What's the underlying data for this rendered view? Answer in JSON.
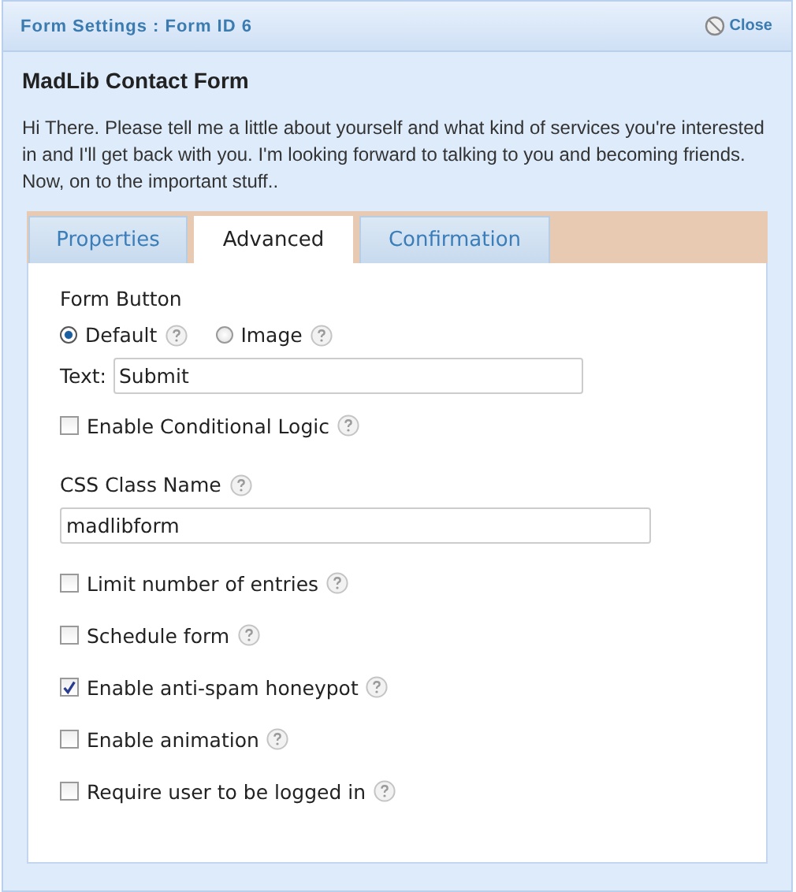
{
  "header": {
    "title": "Form Settings : Form ID 6",
    "close_label": "Close"
  },
  "form_title": "MadLib Contact Form",
  "description": "Hi There. Please tell me a little about yourself and what kind of services you're interested in and I'll get back with you. I'm looking forward to talking to you and becoming friends. Now, on to the important stuff..",
  "tabs": [
    {
      "label": "Properties",
      "selected": false
    },
    {
      "label": "Advanced",
      "selected": true
    },
    {
      "label": "Confirmation",
      "selected": false
    }
  ],
  "form_button": {
    "label": "Form Button",
    "radios": [
      {
        "label": "Default",
        "selected": true
      },
      {
        "label": "Image",
        "selected": false
      }
    ],
    "text_label": "Text:",
    "text_value": "Submit"
  },
  "conditional_logic": {
    "label": "Enable Conditional Logic",
    "checked": false
  },
  "css_class": {
    "label": "CSS Class Name",
    "value": "madlibform"
  },
  "options": [
    {
      "label": "Limit number of entries",
      "checked": false
    },
    {
      "label": "Schedule form",
      "checked": false
    },
    {
      "label": "Enable anti-spam honeypot",
      "checked": true
    },
    {
      "label": "Enable animation",
      "checked": false
    },
    {
      "label": "Require user to be logged in",
      "checked": false
    }
  ]
}
